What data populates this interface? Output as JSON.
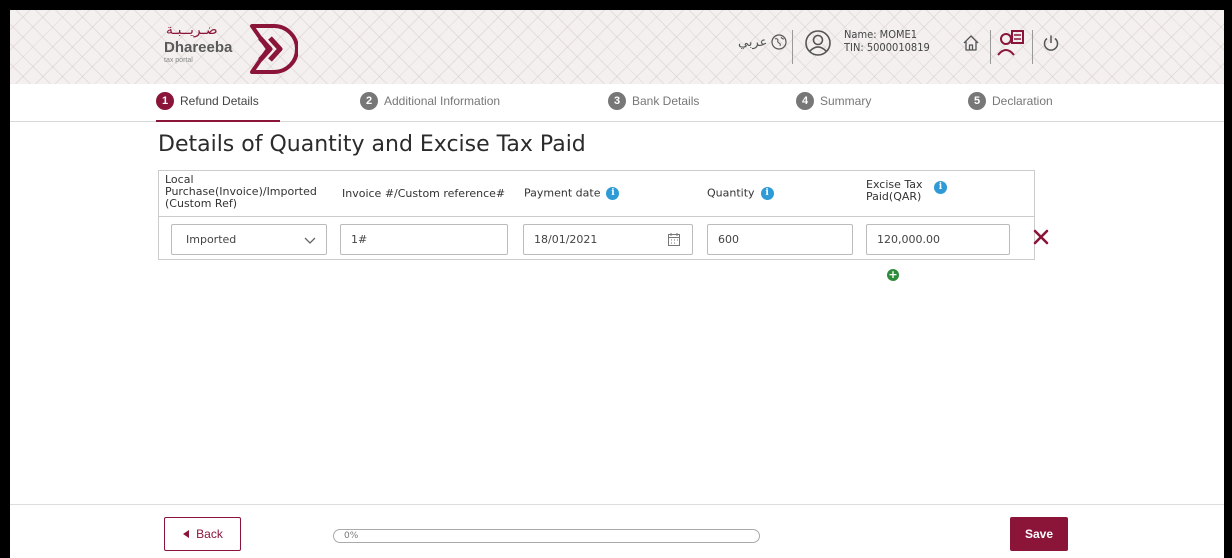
{
  "logo": {
    "arabic": "ضـريــبـة",
    "name": "Dhareeba",
    "subtitle": "tax portal"
  },
  "header": {
    "language_label": "عربي",
    "user_name": "Name: MOME1",
    "user_tin": "TIN: 5000010819"
  },
  "steps": [
    {
      "num": "1",
      "label": "Refund Details",
      "active": true
    },
    {
      "num": "2",
      "label": "Additional Information",
      "active": false
    },
    {
      "num": "3",
      "label": "Bank Details",
      "active": false
    },
    {
      "num": "4",
      "label": "Summary",
      "active": false
    },
    {
      "num": "5",
      "label": "Declaration",
      "active": false
    }
  ],
  "page_title": "Details of Quantity and Excise Tax Paid",
  "table": {
    "headers": {
      "type": "Local Purchase(Invoice)/Imported (Custom Ref)",
      "reference": "Invoice #/Custom reference#",
      "payment_date": "Payment date",
      "quantity": "Quantity",
      "excise_tax": "Excise Tax Paid(QAR)"
    },
    "rows": [
      {
        "type": "Imported",
        "reference": "1#",
        "payment_date": "18/01/2021",
        "quantity": "600",
        "excise_tax": "120,000.00"
      }
    ]
  },
  "footer": {
    "back_label": "Back",
    "progress": 0,
    "progress_label": "0%",
    "save_label": "Save"
  },
  "colors": {
    "brand": "#8a1538",
    "info": "#2e9ad6",
    "add": "#2e8b3a"
  }
}
